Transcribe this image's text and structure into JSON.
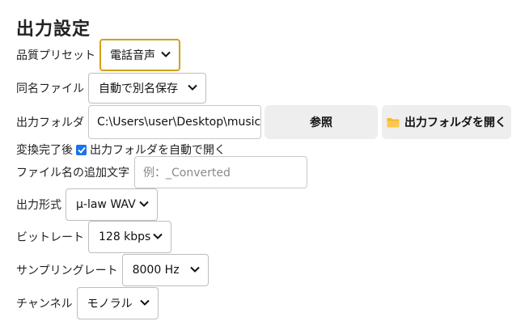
{
  "title": "出力設定",
  "quality_preset": {
    "label": "品質プリセット",
    "value": "電話音声"
  },
  "same_name": {
    "label": "同名ファイル",
    "value": "自動で別名保存"
  },
  "output_folder": {
    "label": "出力フォルダ",
    "value": "C:\\Users\\user\\Desktop\\music",
    "browse_label": "参照",
    "open_label": "出力フォルダを開く"
  },
  "after_convert": {
    "label": "変換完了後",
    "checkbox_label": "出力フォルダを自動で開く",
    "checked": true
  },
  "suffix": {
    "label": "ファイル名の追加文字",
    "placeholder": "例：_Converted"
  },
  "format": {
    "label": "出力形式",
    "value": "μ-law WAV"
  },
  "bitrate": {
    "label": "ビットレート",
    "value": "128 kbps"
  },
  "sample_rate": {
    "label": "サンプリングレート",
    "value": "8000 Hz"
  },
  "channel": {
    "label": "チャンネル",
    "value": "モノラル"
  },
  "colors": {
    "focus_border": "#d4a017",
    "checkbox": "#1a73e8",
    "button_bg": "#eeeeee",
    "folder_icon": "#f5b82e"
  }
}
